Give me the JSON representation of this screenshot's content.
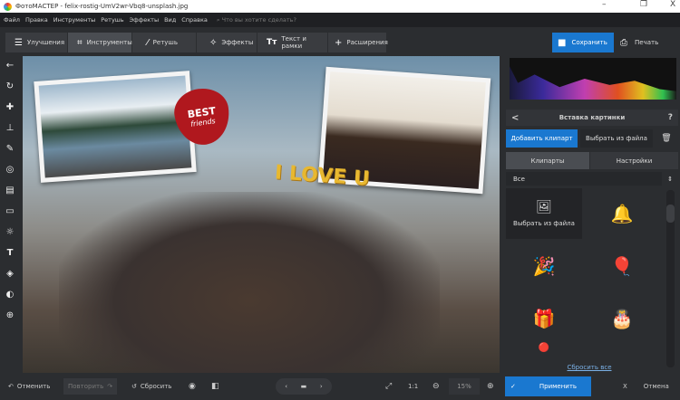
{
  "window": {
    "title": "ФотоМАСТЕР - felix-rostig-UmV2wr-Vbq8-unsplash.jpg",
    "minimize": "–",
    "maximize": "❐",
    "close": "X"
  },
  "menu": {
    "items": [
      "Файл",
      "Правка",
      "Инструменты",
      "Ретушь",
      "Эффекты",
      "Вид",
      "Справка"
    ],
    "search_placeholder": "Что вы хотите сделать?"
  },
  "tabs": [
    {
      "label": "Улучшения",
      "icon": "sliders-icon",
      "glyph": "☰"
    },
    {
      "label": "Инструменты",
      "icon": "crop-icon",
      "glyph": "⌗"
    },
    {
      "label": "Ретушь",
      "icon": "brush-icon",
      "glyph": "⁄"
    },
    {
      "label": "Эффекты",
      "icon": "magic-wand-icon",
      "glyph": "✧"
    },
    {
      "label": "Текст и рамки",
      "icon": "text-icon",
      "glyph": "Tт"
    },
    {
      "label": "Расширения",
      "icon": "plus-icon",
      "glyph": "+"
    }
  ],
  "actions": {
    "save": "Сохранить",
    "print": "Печать"
  },
  "canvas": {
    "heart_line1": "BEST",
    "heart_line2": "friends",
    "sticker_text": "I LOVE U"
  },
  "panel": {
    "title": "Вставка картинки",
    "help": "?",
    "back": "<",
    "add_clipart": "Добавить клипарт",
    "choose_file": "Выбрать из файла",
    "tab_cliparts": "Клипарты",
    "tab_settings": "Настройки",
    "category": "Все",
    "choose_file_cell": "Выбрать из файла",
    "reset_all": "Сбросить все",
    "clipart_items": [
      "bells",
      "party-hat",
      "balloons",
      "gift-red",
      "gift-white",
      "ornament",
      "cone"
    ]
  },
  "bottom": {
    "undo": "Отменить",
    "redo": "Повторить",
    "reset": "Сбросить",
    "ratio": "1:1",
    "zoom": "15%",
    "apply": "Применить",
    "cancel": "Отмена"
  },
  "colors": {
    "accent": "#1a78d0",
    "bg": "#2b2d30"
  }
}
